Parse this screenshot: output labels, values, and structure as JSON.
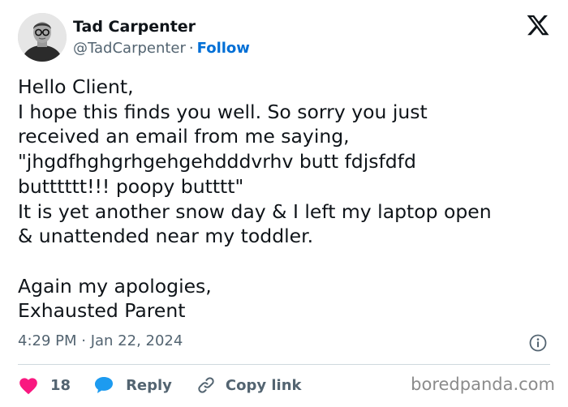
{
  "author": {
    "name": "Tad Carpenter",
    "handle": "@TadCarpenter",
    "separator": "·",
    "follow_label": "Follow"
  },
  "tweet": {
    "text": "Hello Client,\nI hope this finds you well. So sorry you just\nreceived an email from me saying,\n\"jhgdfhghgrhgehgehdddvrhv butt fdjsfdfd\nbutttttt!!! poopy butttt\"\nIt is yet another snow day & I left my laptop open\n& unattended near my toddler.\n\nAgain my apologies,\nExhausted Parent",
    "timestamp": "4:29 PM · Jan 22, 2024"
  },
  "actions": {
    "like_count": "18",
    "reply_label": "Reply",
    "copy_link_label": "Copy link"
  },
  "watermark": "boredpanda.com",
  "icons": {
    "x_logo": "x-logo-icon",
    "info": "info-icon",
    "heart": "heart-icon",
    "reply": "speech-bubble-icon",
    "copy_link": "link-icon"
  },
  "colors": {
    "heart": "#f91880",
    "reply": "#1d9bf0",
    "follow": "#006fd6",
    "secondary_text": "#536471"
  }
}
